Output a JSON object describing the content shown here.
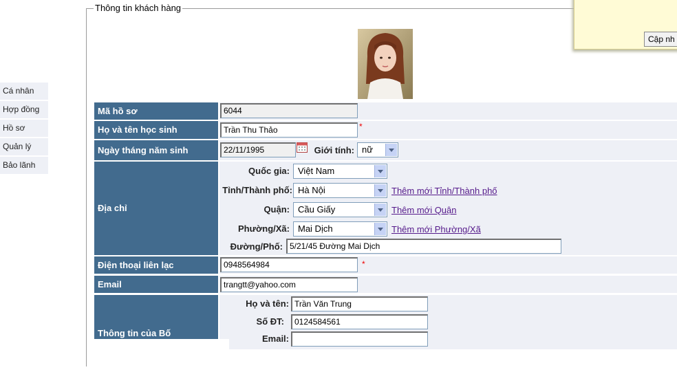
{
  "legend": "Thông tin khách hàng",
  "popup": {
    "update_label": "Cập nh"
  },
  "side_menu": [
    "Cá nhân",
    "Hợp đồng",
    "Hồ sơ",
    "Quản lý",
    "Bảo lãnh"
  ],
  "form": {
    "ma_ho_so": {
      "label": "Mã hồ sơ",
      "value": "6044"
    },
    "ho_ten": {
      "label": "Họ và tên học sinh",
      "value": "Trần Thu Thảo",
      "required": "*"
    },
    "ngay_sinh": {
      "label": "Ngày tháng năm sinh",
      "value": "22/11/1995"
    },
    "gioi_tinh": {
      "label": "Giới tính:",
      "value": "nữ"
    },
    "dia_chi": {
      "label": "Địa chỉ",
      "quoc_gia": {
        "label": "Quốc gia:",
        "value": "Việt Nam"
      },
      "tinh": {
        "label": "Tỉnh/Thành phố:",
        "value": "Hà Nội",
        "link": "Thêm mới Tỉnh/Thành phố"
      },
      "quan": {
        "label": "Quận:",
        "value": "Cầu Giấy",
        "link": "Thêm mới Quận"
      },
      "phuong": {
        "label": "Phường/Xã:",
        "value": "Mai Dịch",
        "link": "Thêm mới Phường/Xã"
      },
      "duong": {
        "label": "Đường/Phố:",
        "value": "5/21/45 Đường Mai Dịch"
      }
    },
    "dien_thoai": {
      "label": "Điện thoại liên lạc",
      "value": "0948564984",
      "required": "*"
    },
    "email": {
      "label": "Email",
      "value": "trangtt@yahoo.com"
    },
    "bo": {
      "label": "Thông tin của Bố",
      "ho_ten": {
        "label": "Họ và tên:",
        "value": "Trần Văn Trung"
      },
      "so_dt": {
        "label": "Số ĐT:",
        "value": "0124584561"
      },
      "email": {
        "label": "Email:",
        "value": ""
      }
    }
  }
}
